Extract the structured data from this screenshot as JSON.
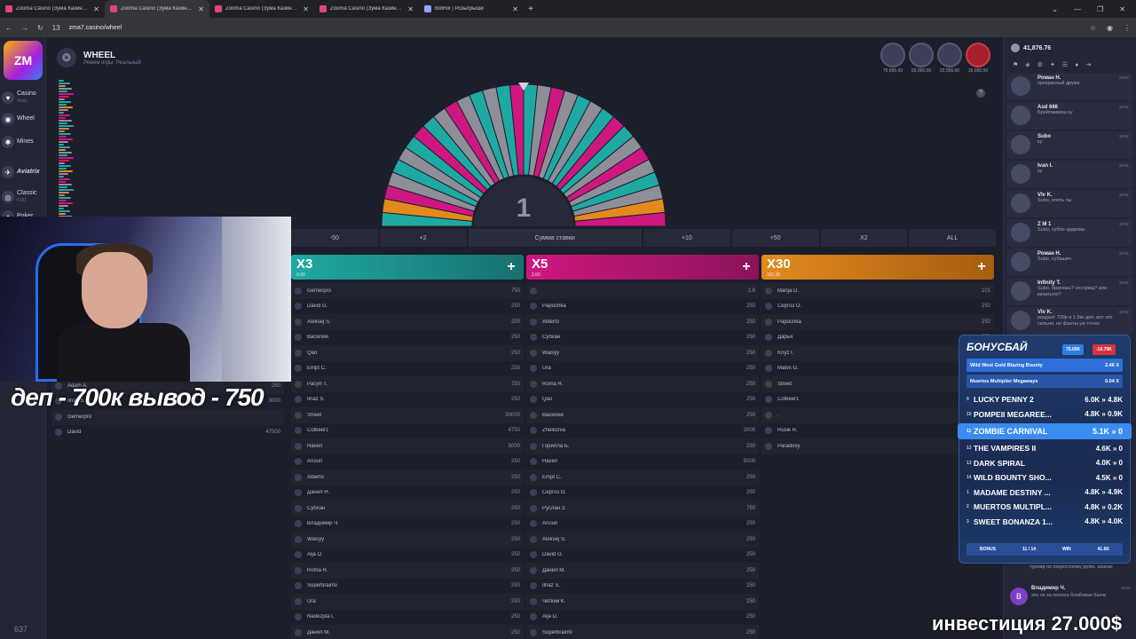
{
  "browser": {
    "tabs": [
      {
        "title": "Zooma Casino (Зума Казино) о",
        "active": false
      },
      {
        "title": "Zooma Casino (Зума Казино) о",
        "active": true
      },
      {
        "title": "Zooma Casino (Зума Казино) о",
        "active": false
      },
      {
        "title": "Zooma Casino (Зума Казино) о",
        "active": false
      },
      {
        "title": "BotRix | Розыгрыши",
        "active": false
      }
    ],
    "url": "zma7.casino/wheel",
    "tab_count": "13"
  },
  "leftnav": {
    "logo": "ZM",
    "items": [
      {
        "label": "Casino",
        "sub": "Slots",
        "icon": "♥"
      },
      {
        "label": "Wheel",
        "sub": "",
        "icon": "◉"
      },
      {
        "label": "Mines",
        "sub": "",
        "icon": "✱"
      },
      {
        "label": "Aviatrix",
        "sub": "",
        "icon": "✈"
      },
      {
        "label": "Classic",
        "sub": "0.00",
        "icon": "◎"
      },
      {
        "label": "Poker",
        "sub": "",
        "icon": "♠"
      }
    ],
    "count": "637"
  },
  "game": {
    "title": "WHEEL",
    "mode": "Режим игры: Реальный",
    "center_number": "1",
    "players_online": [
      "79,695.00",
      "50,000.00",
      "20,556.00",
      "16,650.00"
    ]
  },
  "betbar": [
    "-50",
    "+2",
    "Сумма ставки",
    "+10",
    "+50",
    "X2",
    "ALL"
  ],
  "columns": [
    {
      "mult": "X3",
      "total": "0.00",
      "color": "#1fa9a3",
      "rows": [
        {
          "name": "Gemerpro",
          "amount": "750"
        },
        {
          "name": "David G.",
          "amount": "250"
        },
        {
          "name": "Aleksej S.",
          "amount": "200"
        },
        {
          "name": "Василий",
          "amount": "250"
        },
        {
          "name": "Qao",
          "amount": "250"
        },
        {
          "name": "Empt C.",
          "amount": "250"
        },
        {
          "name": "Pacyn T.",
          "amount": "750"
        },
        {
          "name": "Ilnaz S.",
          "amount": "250"
        },
        {
          "name": "Street",
          "amount": "50000"
        },
        {
          "name": "Colbeer1",
          "amount": "4750"
        },
        {
          "name": "Haven",
          "amount": "5000"
        },
        {
          "name": "Anoun",
          "amount": "250"
        },
        {
          "name": "Alberto",
          "amount": "250"
        },
        {
          "name": "Данил Н.",
          "amount": "250"
        },
        {
          "name": "Субхан",
          "amount": "250"
        },
        {
          "name": "Владимир Ч.",
          "amount": "250"
        },
        {
          "name": "Waisyy",
          "amount": "250"
        },
        {
          "name": "Alja D.",
          "amount": "250"
        },
        {
          "name": "Roma R.",
          "amount": "250"
        },
        {
          "name": "Superbraintv",
          "amount": "250"
        },
        {
          "name": "Ura",
          "amount": "250"
        },
        {
          "name": "Nadezjda I.",
          "amount": "250"
        },
        {
          "name": "Данил М.",
          "amount": "250"
        }
      ]
    },
    {
      "mult": "X5",
      "total": "2.60",
      "color": "#cf1781",
      "rows": [
        {
          "name": "",
          "amount": "2.6"
        },
        {
          "name": "Papochka",
          "amount": "250"
        },
        {
          "name": "Alberto",
          "amount": "250"
        },
        {
          "name": "Субхан",
          "amount": "250"
        },
        {
          "name": "Waisyy",
          "amount": "250"
        },
        {
          "name": "Ura",
          "amount": "250"
        },
        {
          "name": "Roma R.",
          "amount": "250"
        },
        {
          "name": "Qao",
          "amount": "250"
        },
        {
          "name": "Василий",
          "amount": "250"
        },
        {
          "name": "Zheleznia",
          "amount": "2000"
        },
        {
          "name": "Горилла Б.",
          "amount": "250"
        },
        {
          "name": "Haven",
          "amount": "5000"
        },
        {
          "name": "Empt C.",
          "amount": "250"
        },
        {
          "name": "Сергоз О.",
          "amount": "250"
        },
        {
          "name": "Руслан З.",
          "amount": "750"
        },
        {
          "name": "Anoun",
          "amount": "250"
        },
        {
          "name": "Aleksej S.",
          "amount": "250"
        },
        {
          "name": "David G.",
          "amount": "250"
        },
        {
          "name": "Данил М.",
          "amount": "250"
        },
        {
          "name": "Ilnaz S.",
          "amount": "250"
        },
        {
          "name": "Четкий К.",
          "amount": "250"
        },
        {
          "name": "Alja D.",
          "amount": "250"
        },
        {
          "name": "Superbraintv",
          "amount": "250"
        }
      ]
    },
    {
      "mult": "X30",
      "total": "101.00",
      "color": "#e28a1e",
      "rows": [
        {
          "name": "Manja D.",
          "amount": "101"
        },
        {
          "name": "Сергоз О.",
          "amount": "250"
        },
        {
          "name": "Papochka",
          "amount": "250"
        },
        {
          "name": "Дарья",
          "amount": "250"
        },
        {
          "name": "Knyz I.",
          "amount": "250"
        },
        {
          "name": "Matvii G.",
          "amount": "250"
        },
        {
          "name": "Street",
          "amount": "250"
        },
        {
          "name": "Colbeer1",
          "amount": "250"
        },
        {
          "name": ".",
          "amount": "250"
        },
        {
          "name": "Rusik R.",
          "amount": "250"
        },
        {
          "name": "Paradoxy",
          "amount": "250"
        }
      ]
    }
  ],
  "left_players": [
    {
      "name": "Adam A.",
      "amount": "250"
    },
    {
      "name": "Ilnaz S.",
      "amount": "3000"
    },
    {
      "name": "Gemerpro",
      "amount": ""
    },
    {
      "name": "David",
      "amount": "47500"
    }
  ],
  "overlays": {
    "dep": "деп - 700к вывод - 750",
    "invest": "инвестиция 27.000$"
  },
  "chat": {
    "balance": "41,876.76",
    "messages": [
      {
        "name": "Роман Н.",
        "text": "прекрасный друже",
        "time": "18:57"
      },
      {
        "name": "Asd 666",
        "text": "Брейтмиииш ку",
        "time": "19:01"
      },
      {
        "name": "Subo",
        "text": "ку",
        "time": "19:01"
      },
      {
        "name": "Ivan I.",
        "text": "ку",
        "time": "19:01"
      },
      {
        "name": "Vlv K.",
        "text": "Subo, опять ты",
        "time": "19:01"
      },
      {
        "name": "Z M 1",
        "text": "Subo, субло здарова",
        "time": "19:01"
      },
      {
        "name": "Роман Н.",
        "text": "Subo, субашич",
        "time": "19:01"
      },
      {
        "name": "Infinity T.",
        "text": "Subo, братишь? сестрищ? или кипитыто?",
        "time": "19:01"
      },
      {
        "name": "Vlv K.",
        "text": "раздает 700р и 1.5кк деп, вот это сильно, не фанты уж точно",
        "time": "19:01"
      }
    ],
    "partial": "турнир по скоростному рулю, ахахах",
    "last": {
      "initial": "В",
      "name": "Владимир Ч.",
      "text": "это че за полоса бомбовая была",
      "time": "19:01"
    }
  },
  "bonus": {
    "title": "БОНУСБАЙ",
    "pill1": "75.00K",
    "pill2": "-10.70K",
    "top1_name": "Wild West Gold Blazing Bounty",
    "top1_val": "2.46 X",
    "top2_name": "Muertos Multiplier Megaways",
    "top2_val": "0.04 X",
    "rows_top": [
      {
        "idx": "9",
        "name": "LUCKY PENNY 2",
        "val": "6.0K » 4.8K"
      },
      {
        "idx": "10",
        "name": "POMPEII MEGAREE...",
        "val": "4.8K » 0.9K"
      }
    ],
    "highlight": {
      "idx": "11",
      "name": "ZOMBIE CARNIVAL",
      "val": "5.1K » 0"
    },
    "rows_bottom": [
      {
        "idx": "12",
        "name": "THE VAMPIRES II",
        "val": "4.6K » 0"
      },
      {
        "idx": "13",
        "name": "DARK SPIRAL",
        "val": "4.0K » 0"
      },
      {
        "idx": "14",
        "name": "WILD BOUNTY SHO...",
        "val": "4.5K » 0"
      },
      {
        "idx": "1",
        "name": "MADAME DESTINY ...",
        "val": "4.8K » 4.9K"
      },
      {
        "idx": "2",
        "name": "MUERTOS MULTIPL...",
        "val": "4.8K » 0.2K"
      },
      {
        "idx": "3",
        "name": "SWEET BONANZA 1...",
        "val": "4.8K » 4.0K"
      }
    ],
    "foot": {
      "bonus_label": "BONUS",
      "bonus_val": "11 / 14",
      "win_label": "WIN",
      "win_val": "41.6K"
    }
  }
}
